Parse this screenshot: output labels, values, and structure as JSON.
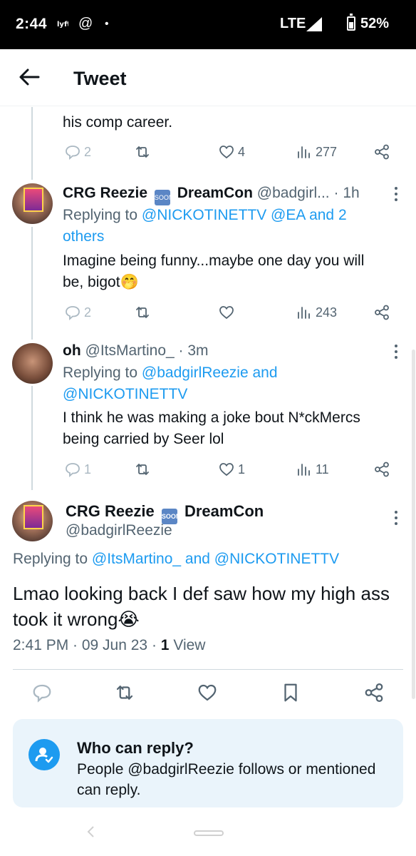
{
  "status_bar": {
    "time": "2:44",
    "icons": [
      "lyft-icon",
      "at-icon",
      "dot-icon"
    ],
    "at_glyph": "@",
    "dot_glyph": "•",
    "network": "LTE",
    "battery": "52%"
  },
  "header": {
    "title": "Tweet"
  },
  "prev_fragment": "his comp career.",
  "replies": [
    {
      "actions": {
        "replies": "2",
        "retweets": "",
        "likes": "4",
        "views": "277"
      }
    },
    {
      "name": "CRG Reezie",
      "name_suffix": "DreamCon",
      "handle": "@badgirl...",
      "time": "· 1h",
      "replying_prefix": "Replying to",
      "replying_line1": "@NICKOTINETTV @EA and 2",
      "replying_line2": "others",
      "text_line1": "Imagine being funny...maybe one day you will",
      "text_line2": "be, bigot🤭",
      "actions": {
        "replies": "2",
        "retweets": "",
        "likes": "",
        "views": "243"
      }
    },
    {
      "name": "oh",
      "handle": "@ItsMartino_",
      "time": "· 3m",
      "replying_prefix": "Replying to",
      "replying_line1": "@badgirlReezie and",
      "replying_line2": "@NICKOTINETTV",
      "text_line1": "I think he was making a joke bout N*ckMercs",
      "text_line2": "being carried by Seer lol",
      "actions": {
        "replies": "1",
        "retweets": "",
        "likes": "1",
        "views": "11"
      }
    }
  ],
  "main_tweet": {
    "name": "CRG Reezie",
    "name_suffix": "DreamCon",
    "soon_label": "SOON",
    "handle": "@badgirlReezie",
    "replying_prefix": "Replying to",
    "replying_to": "@ItsMartino_ and @NICKOTINETTV",
    "text": "Lmao looking back I def saw how my high ass took it wrong😭",
    "time": "2:41 PM · 09 Jun 23 ·",
    "views_count": "1",
    "views_label": "View"
  },
  "who_can_reply": {
    "title": "Who can reply?",
    "description": "People @badgirlReezie follows or mentioned can reply."
  },
  "colors": {
    "accent": "#1d9bf0",
    "muted": "#536471",
    "text": "#0f1419"
  }
}
